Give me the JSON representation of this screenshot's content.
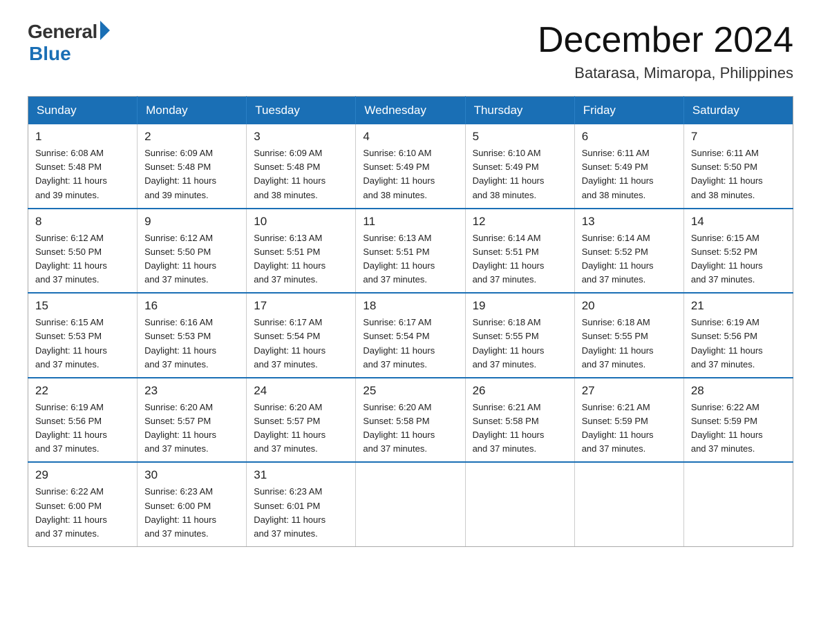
{
  "header": {
    "logo_general": "General",
    "logo_blue": "Blue",
    "title": "December 2024",
    "subtitle": "Batarasa, Mimaropa, Philippines"
  },
  "days_of_week": [
    "Sunday",
    "Monday",
    "Tuesday",
    "Wednesday",
    "Thursday",
    "Friday",
    "Saturday"
  ],
  "weeks": [
    [
      {
        "day": "1",
        "sunrise": "6:08 AM",
        "sunset": "5:48 PM",
        "daylight": "11 hours and 39 minutes."
      },
      {
        "day": "2",
        "sunrise": "6:09 AM",
        "sunset": "5:48 PM",
        "daylight": "11 hours and 39 minutes."
      },
      {
        "day": "3",
        "sunrise": "6:09 AM",
        "sunset": "5:48 PM",
        "daylight": "11 hours and 38 minutes."
      },
      {
        "day": "4",
        "sunrise": "6:10 AM",
        "sunset": "5:49 PM",
        "daylight": "11 hours and 38 minutes."
      },
      {
        "day": "5",
        "sunrise": "6:10 AM",
        "sunset": "5:49 PM",
        "daylight": "11 hours and 38 minutes."
      },
      {
        "day": "6",
        "sunrise": "6:11 AM",
        "sunset": "5:49 PM",
        "daylight": "11 hours and 38 minutes."
      },
      {
        "day": "7",
        "sunrise": "6:11 AM",
        "sunset": "5:50 PM",
        "daylight": "11 hours and 38 minutes."
      }
    ],
    [
      {
        "day": "8",
        "sunrise": "6:12 AM",
        "sunset": "5:50 PM",
        "daylight": "11 hours and 37 minutes."
      },
      {
        "day": "9",
        "sunrise": "6:12 AM",
        "sunset": "5:50 PM",
        "daylight": "11 hours and 37 minutes."
      },
      {
        "day": "10",
        "sunrise": "6:13 AM",
        "sunset": "5:51 PM",
        "daylight": "11 hours and 37 minutes."
      },
      {
        "day": "11",
        "sunrise": "6:13 AM",
        "sunset": "5:51 PM",
        "daylight": "11 hours and 37 minutes."
      },
      {
        "day": "12",
        "sunrise": "6:14 AM",
        "sunset": "5:51 PM",
        "daylight": "11 hours and 37 minutes."
      },
      {
        "day": "13",
        "sunrise": "6:14 AM",
        "sunset": "5:52 PM",
        "daylight": "11 hours and 37 minutes."
      },
      {
        "day": "14",
        "sunrise": "6:15 AM",
        "sunset": "5:52 PM",
        "daylight": "11 hours and 37 minutes."
      }
    ],
    [
      {
        "day": "15",
        "sunrise": "6:15 AM",
        "sunset": "5:53 PM",
        "daylight": "11 hours and 37 minutes."
      },
      {
        "day": "16",
        "sunrise": "6:16 AM",
        "sunset": "5:53 PM",
        "daylight": "11 hours and 37 minutes."
      },
      {
        "day": "17",
        "sunrise": "6:17 AM",
        "sunset": "5:54 PM",
        "daylight": "11 hours and 37 minutes."
      },
      {
        "day": "18",
        "sunrise": "6:17 AM",
        "sunset": "5:54 PM",
        "daylight": "11 hours and 37 minutes."
      },
      {
        "day": "19",
        "sunrise": "6:18 AM",
        "sunset": "5:55 PM",
        "daylight": "11 hours and 37 minutes."
      },
      {
        "day": "20",
        "sunrise": "6:18 AM",
        "sunset": "5:55 PM",
        "daylight": "11 hours and 37 minutes."
      },
      {
        "day": "21",
        "sunrise": "6:19 AM",
        "sunset": "5:56 PM",
        "daylight": "11 hours and 37 minutes."
      }
    ],
    [
      {
        "day": "22",
        "sunrise": "6:19 AM",
        "sunset": "5:56 PM",
        "daylight": "11 hours and 37 minutes."
      },
      {
        "day": "23",
        "sunrise": "6:20 AM",
        "sunset": "5:57 PM",
        "daylight": "11 hours and 37 minutes."
      },
      {
        "day": "24",
        "sunrise": "6:20 AM",
        "sunset": "5:57 PM",
        "daylight": "11 hours and 37 minutes."
      },
      {
        "day": "25",
        "sunrise": "6:20 AM",
        "sunset": "5:58 PM",
        "daylight": "11 hours and 37 minutes."
      },
      {
        "day": "26",
        "sunrise": "6:21 AM",
        "sunset": "5:58 PM",
        "daylight": "11 hours and 37 minutes."
      },
      {
        "day": "27",
        "sunrise": "6:21 AM",
        "sunset": "5:59 PM",
        "daylight": "11 hours and 37 minutes."
      },
      {
        "day": "28",
        "sunrise": "6:22 AM",
        "sunset": "5:59 PM",
        "daylight": "11 hours and 37 minutes."
      }
    ],
    [
      {
        "day": "29",
        "sunrise": "6:22 AM",
        "sunset": "6:00 PM",
        "daylight": "11 hours and 37 minutes."
      },
      {
        "day": "30",
        "sunrise": "6:23 AM",
        "sunset": "6:00 PM",
        "daylight": "11 hours and 37 minutes."
      },
      {
        "day": "31",
        "sunrise": "6:23 AM",
        "sunset": "6:01 PM",
        "daylight": "11 hours and 37 minutes."
      },
      null,
      null,
      null,
      null
    ]
  ],
  "labels": {
    "sunrise": "Sunrise:",
    "sunset": "Sunset:",
    "daylight": "Daylight:"
  }
}
